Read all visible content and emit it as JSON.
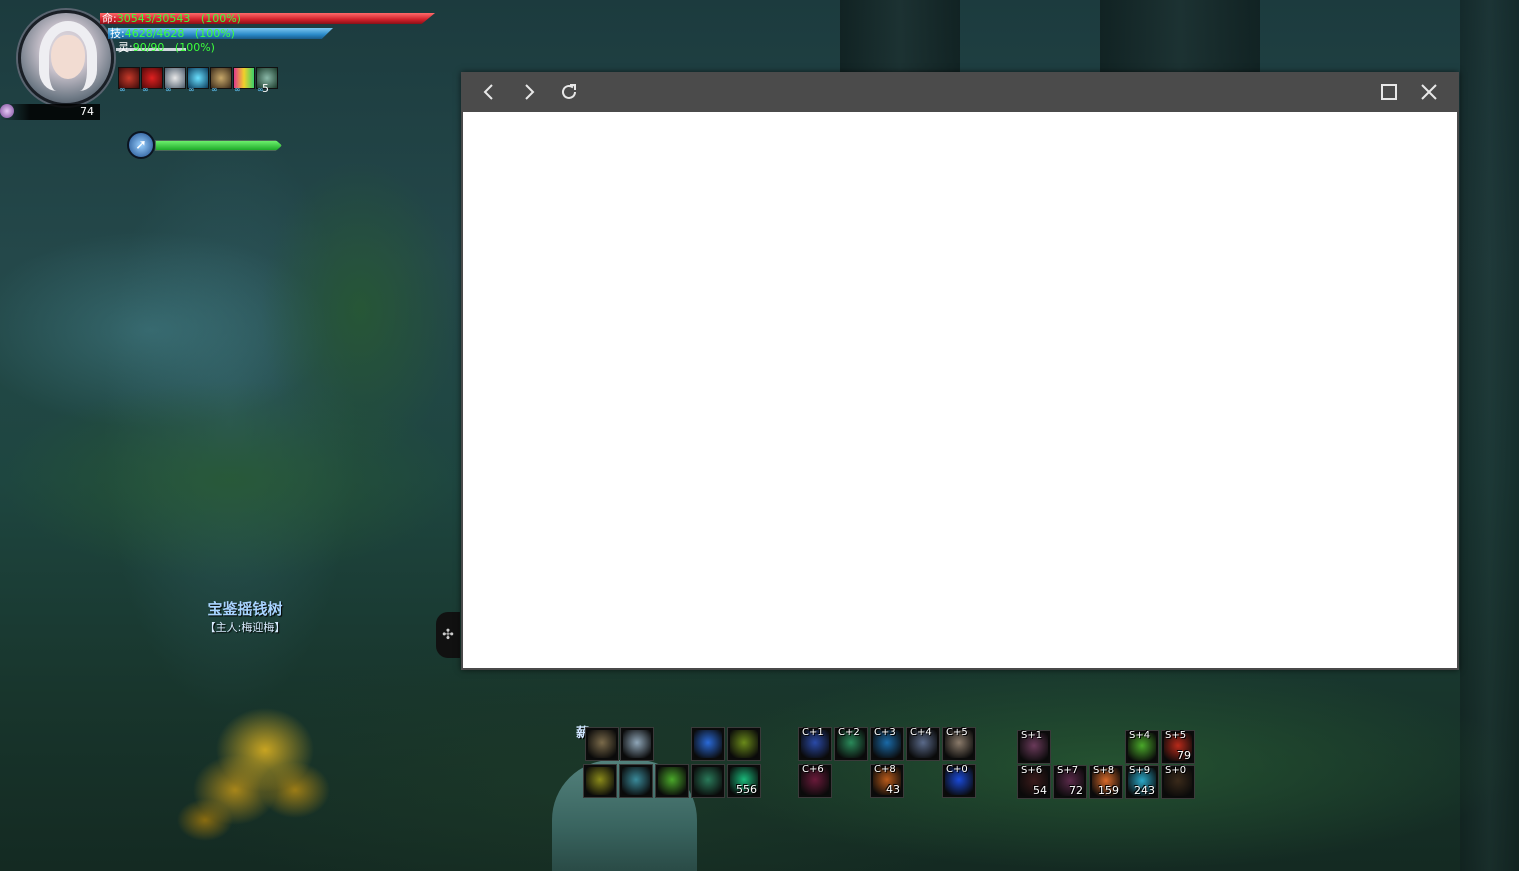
{
  "player": {
    "level": "74",
    "hp": {
      "label": "命:",
      "value": "30543/30543",
      "pct": "(100%)"
    },
    "skill": {
      "label": "技:",
      "value": "4628/4628",
      "pct": "(100%)"
    },
    "spirit": {
      "label": "灵:",
      "value": "90/90",
      "pct": "(100%)"
    },
    "buff_stack": "5"
  },
  "mount": {
    "level_fraction": 1.0
  },
  "npc": {
    "name": "宝鉴摇钱树",
    "owner": "【主人:梅迎梅】"
  },
  "skillbar": {
    "title": "薪",
    "group1_row1": [
      {
        "icon": "eagle-skill-icon",
        "color": "#7a6a4a",
        "key": "",
        "count": ""
      },
      {
        "icon": "arrow-skill-icon",
        "color": "#8fa6b8",
        "key": "",
        "count": ""
      },
      {
        "icon": "lightning-skill-icon",
        "color": "#2a6ad8",
        "key": "",
        "count": ""
      },
      {
        "icon": "vine-skill-icon",
        "color": "#6a8a1a",
        "key": "",
        "count": ""
      }
    ],
    "group1_row2": [
      {
        "icon": "figure-skill-icon",
        "color": "#8a8a1a",
        "key": "",
        "count": ""
      },
      {
        "icon": "portrait-skill-icon",
        "color": "#3a8a9a",
        "key": "",
        "count": ""
      },
      {
        "icon": "wind-skill-icon",
        "color": "#4aa82a",
        "key": "",
        "count": ""
      },
      {
        "icon": "star-skill-icon",
        "color": "#2a7a5a",
        "key": "",
        "count": ""
      },
      {
        "icon": "orb-skill-icon",
        "color": "#1ab87a",
        "key": "",
        "count": "556"
      }
    ],
    "group2_row1": [
      {
        "icon": "blue-flame-icon",
        "color": "#2a4aa8",
        "key": "C+1",
        "count": ""
      },
      {
        "icon": "swirl-icon",
        "color": "#2a8a5a",
        "key": "C+2",
        "count": ""
      },
      {
        "icon": "water-drop-icon",
        "color": "#1a6aa8",
        "key": "C+3",
        "count": ""
      },
      {
        "icon": "wolf-icon",
        "color": "#5a6a8a",
        "key": "C+4",
        "count": ""
      },
      {
        "icon": "crossed-swords-icon",
        "color": "#8a7a6a",
        "key": "C+5",
        "count": ""
      }
    ],
    "group2_row2": [
      {
        "icon": "red-rune-icon",
        "color": "#6a1a3a",
        "key": "C+6",
        "count": ""
      },
      {
        "icon": "flame-claw-icon",
        "color": "#b85a1a",
        "key": "C+8",
        "count": "43"
      },
      {
        "icon": "blue-hook-icon",
        "color": "#1a4ad8",
        "key": "C+0",
        "count": ""
      }
    ],
    "group3_row1": [
      {
        "icon": "character-icon",
        "color": "#6a3a5a",
        "key": "S+1",
        "count": ""
      },
      {
        "icon": "green-gourd-icon",
        "color": "#4aa82a",
        "key": "S+4",
        "count": ""
      },
      {
        "icon": "red-potion-icon",
        "color": "#b82a1a",
        "key": "S+5",
        "count": "79"
      }
    ],
    "group3_row2": [
      {
        "icon": "dark-item-icon",
        "color": "#3a1a1a",
        "key": "S+6",
        "count": "54"
      },
      {
        "icon": "pink-item-icon",
        "color": "#5a2a4a",
        "key": "S+7",
        "count": "72"
      },
      {
        "icon": "orange-flower-icon",
        "color": "#d86a2a",
        "key": "S+8",
        "count": "159"
      },
      {
        "icon": "cyan-orb-icon",
        "color": "#2aa8c8",
        "key": "S+9",
        "count": "243"
      },
      {
        "icon": "dark-sparkle-icon",
        "color": "#3a2a1a",
        "key": "S+0",
        "count": ""
      }
    ]
  },
  "browser": {
    "back": "‹",
    "forward": "›",
    "reload": "↻",
    "maximize": "□",
    "close": "✕"
  }
}
